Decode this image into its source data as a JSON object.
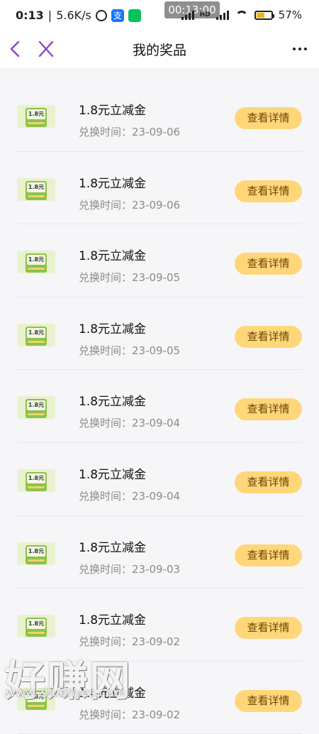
{
  "status_bar": {
    "time": "0:13",
    "network_speed": "5.6K/s",
    "alipay_glyph": "支",
    "timer": "00:13:00",
    "hd_label": "HD",
    "battery_percent": "57%",
    "battery_level": 0.57
  },
  "header": {
    "title": "我的奖品"
  },
  "prizes": [
    {
      "badge": "1.8元",
      "name": "1.8元立减金",
      "date": "兑换时间：23-09-06",
      "button": "查看详情"
    },
    {
      "badge": "1.8元",
      "name": "1.8元立减金",
      "date": "兑换时间：23-09-06",
      "button": "查看详情"
    },
    {
      "badge": "1.8元",
      "name": "1.8元立减金",
      "date": "兑换时间：23-09-05",
      "button": "查看详情"
    },
    {
      "badge": "1.8元",
      "name": "1.8元立减金",
      "date": "兑换时间：23-09-05",
      "button": "查看详情"
    },
    {
      "badge": "1.8元",
      "name": "1.8元立减金",
      "date": "兑换时间：23-09-04",
      "button": "查看详情"
    },
    {
      "badge": "1.8元",
      "name": "1.8元立减金",
      "date": "兑换时间：23-09-04",
      "button": "查看详情"
    },
    {
      "badge": "1.8元",
      "name": "1.8元立减金",
      "date": "兑换时间：23-09-03",
      "button": "查看详情"
    },
    {
      "badge": "1.8元",
      "name": "1.8元立减金",
      "date": "兑换时间：23-09-02",
      "button": "查看详情"
    },
    {
      "badge": "1.8元",
      "name": "1.8元立减金",
      "date": "兑换时间：23-09-02",
      "button": "查看详情"
    }
  ],
  "watermark": {
    "text": "好赚网",
    "url": "www.zhuanyes.com"
  },
  "colors": {
    "accent_purple": "#8e44c4",
    "button_bg": "#ffd77a",
    "button_text": "#6b4200"
  },
  "icons": {
    "back": "chevron-left-icon",
    "close": "close-icon",
    "more": "more-dots-icon"
  }
}
